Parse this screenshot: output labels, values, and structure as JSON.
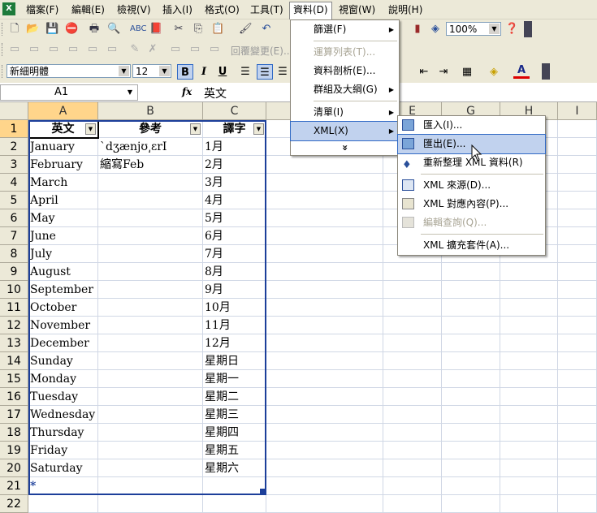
{
  "menubar": {
    "items": [
      "檔案(F)",
      "編輯(E)",
      "檢視(V)",
      "插入(I)",
      "格式(O)",
      "工具(T)",
      "資料(D)",
      "視窗(W)",
      "說明(H)"
    ]
  },
  "toolbar": {
    "zoom": "100%",
    "review_label": "回覆變更(E)...",
    "font_name": "新細明體",
    "font_size": "12",
    "bold": "B",
    "italic": "I",
    "underline": "U"
  },
  "formula_bar": {
    "name_box": "A1",
    "fx": "fx",
    "content": "英文"
  },
  "columns": [
    "A",
    "B",
    "C",
    "E",
    "G",
    "H",
    "I"
  ],
  "rows": [
    "1",
    "2",
    "3",
    "4",
    "5",
    "6",
    "7",
    "8",
    "9",
    "10",
    "11",
    "12",
    "13",
    "14",
    "15",
    "16",
    "17",
    "18",
    "19",
    "20",
    "21",
    "22"
  ],
  "table": {
    "headers": [
      "英文",
      "參考",
      "譯字"
    ],
    "rows": [
      [
        "January",
        "ˋdʒænjʊ͵ɛrI",
        "1月"
      ],
      [
        "February",
        "縮寫Feb",
        "2月"
      ],
      [
        "March",
        "",
        "3月"
      ],
      [
        "April",
        "",
        "4月"
      ],
      [
        "May",
        "",
        "5月"
      ],
      [
        "June",
        "",
        "6月"
      ],
      [
        "July",
        "",
        "7月"
      ],
      [
        "August",
        "",
        "8月"
      ],
      [
        "September",
        "",
        "9月"
      ],
      [
        "October",
        "",
        "10月"
      ],
      [
        "November",
        "",
        "11月"
      ],
      [
        "December",
        "",
        "12月"
      ],
      [
        "Sunday",
        "",
        "星期日"
      ],
      [
        "Monday",
        "",
        "星期一"
      ],
      [
        "Tuesday",
        "",
        "星期二"
      ],
      [
        "Wednesday",
        "",
        "星期三"
      ],
      [
        "Thursday",
        "",
        "星期四"
      ],
      [
        "Friday",
        "",
        "星期五"
      ],
      [
        "Saturday",
        "",
        "星期六"
      ]
    ],
    "insert_row_marker": "*"
  },
  "data_menu": {
    "items": [
      "篩選(F)",
      "運算列表(T)...",
      "資料剖析(E)...",
      "群組及大綱(G)",
      "清單(I)",
      "XML(X)"
    ],
    "expand": "»"
  },
  "xml_submenu": {
    "items": [
      "匯入(I)...",
      "匯出(E)...",
      "重新整理 XML 資料(R)",
      "XML 來源(D)...",
      "XML 對應內容(P)...",
      "編輯查詢(Q)...",
      "XML 擴充套件(A)..."
    ]
  },
  "colors": {
    "toolbar_bg": "#ece9d8",
    "highlight": "#c1d2ee",
    "list_border": "#1c3f9a"
  }
}
